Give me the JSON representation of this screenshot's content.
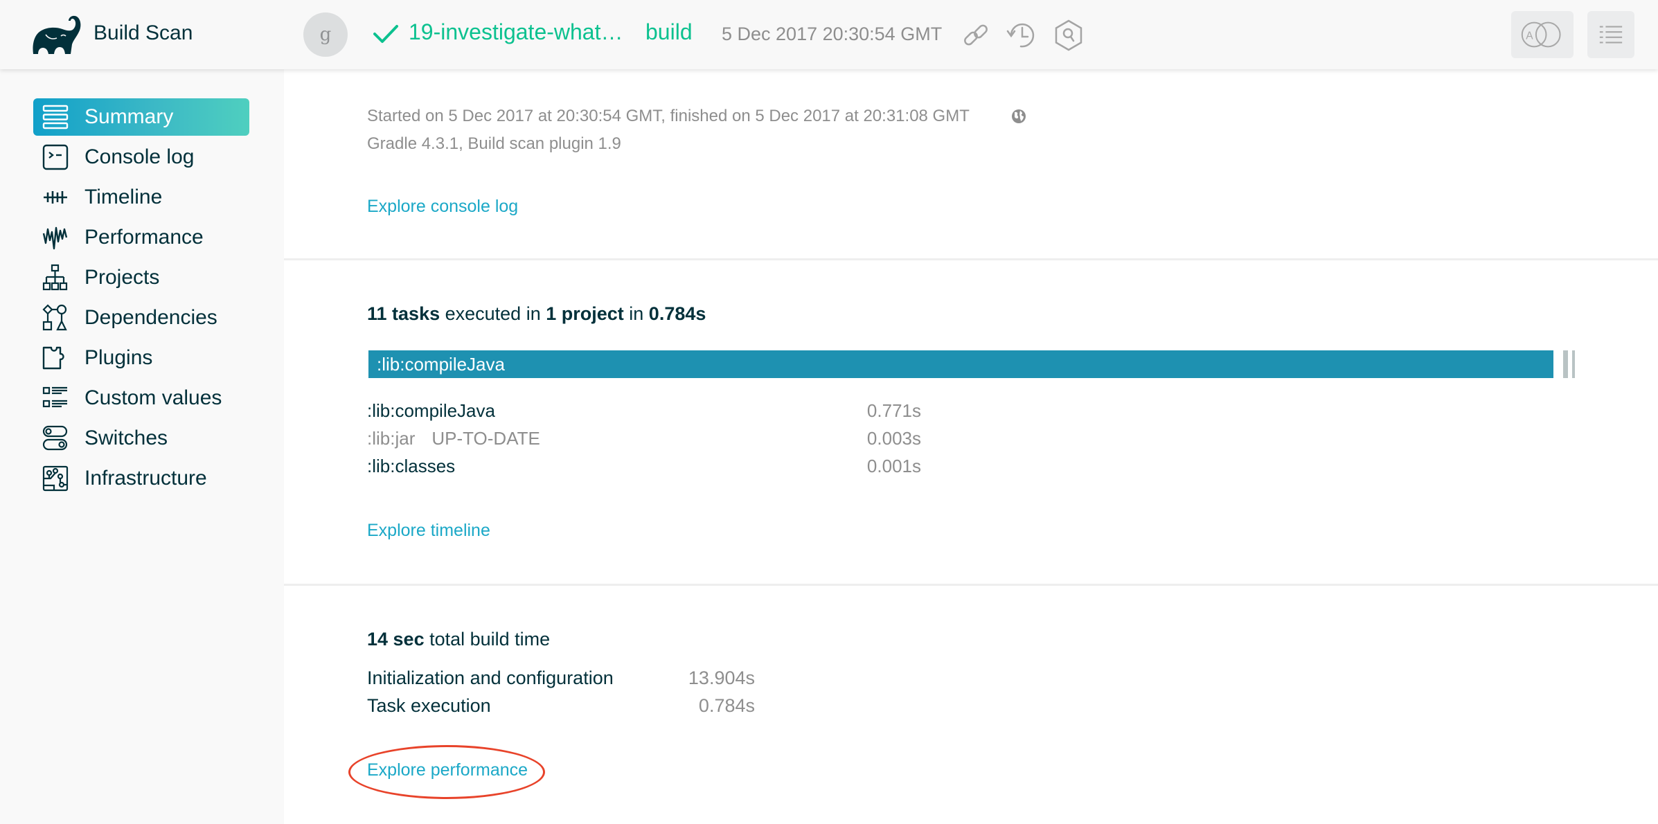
{
  "header": {
    "app_title": "Build Scan",
    "avatar_initial": "g",
    "status": "success",
    "build_title": "19-investigate-what…",
    "build_task": "build",
    "build_time": "5 Dec 2017 20:30:54 GMT",
    "icons": [
      "link-icon",
      "history-icon",
      "search-scans-icon"
    ],
    "buttons": [
      "compare-icon",
      "menu-list-icon"
    ],
    "compare_letter": "A"
  },
  "sidebar": {
    "items": [
      {
        "label": "Summary",
        "icon": "summary-icon",
        "active": true
      },
      {
        "label": "Console log",
        "icon": "console-icon",
        "active": false
      },
      {
        "label": "Timeline",
        "icon": "timeline-icon",
        "active": false
      },
      {
        "label": "Performance",
        "icon": "performance-icon",
        "active": false
      },
      {
        "label": "Projects",
        "icon": "projects-icon",
        "active": false
      },
      {
        "label": "Dependencies",
        "icon": "dependencies-icon",
        "active": false
      },
      {
        "label": "Plugins",
        "icon": "plugins-icon",
        "active": false
      },
      {
        "label": "Custom values",
        "icon": "custom-values-icon",
        "active": false
      },
      {
        "label": "Switches",
        "icon": "switches-icon",
        "active": false
      },
      {
        "label": "Infrastructure",
        "icon": "infrastructure-icon",
        "active": false
      }
    ]
  },
  "summary": {
    "started_line": "Started on 5 Dec 2017 at 20:30:54 GMT, finished on 5 Dec 2017 at 20:31:08 GMT",
    "version_line": "Gradle 4.3.1,  Build scan plugin 1.9",
    "explore_console_log": "Explore console log"
  },
  "tasks": {
    "heading": {
      "count": "11 tasks",
      "mid1": " executed in ",
      "projects": "1 project",
      "mid2": " in ",
      "duration": "0.784s"
    },
    "timeline": {
      "total_seconds": 0.784,
      "bars": [
        {
          "label": ":lib:compileJava",
          "duration_s": 0.771,
          "color": "#1e91b1"
        },
        {
          "label": ":lib:jar",
          "duration_s": 0.003,
          "color": "#b9c3c4"
        },
        {
          "label": ":lib:classes",
          "duration_s": 0.001,
          "color": "#b9c3c4"
        }
      ]
    },
    "rows": [
      {
        "name": ":lib:compileJava",
        "status": "",
        "duration": "0.771s",
        "dim": false
      },
      {
        "name": ":lib:jar",
        "status": "UP-TO-DATE",
        "duration": "0.003s",
        "dim": true
      },
      {
        "name": ":lib:classes",
        "status": "",
        "duration": "0.001s",
        "dim": false
      }
    ],
    "explore_timeline": "Explore timeline"
  },
  "build_time": {
    "heading_bold": "14 sec",
    "heading_rest": " total build time",
    "rows": [
      {
        "label": "Initialization and configuration",
        "value": "13.904s"
      },
      {
        "label": "Task execution",
        "value": "0.784s"
      }
    ],
    "explore_performance": "Explore performance"
  },
  "colors": {
    "accent": "#1ba8c7",
    "success": "#0cc18f",
    "text_dark": "#02303a",
    "text_muted": "#8e8e8e",
    "timeline_bar": "#1e91b1",
    "annotation": "#e8432a"
  }
}
